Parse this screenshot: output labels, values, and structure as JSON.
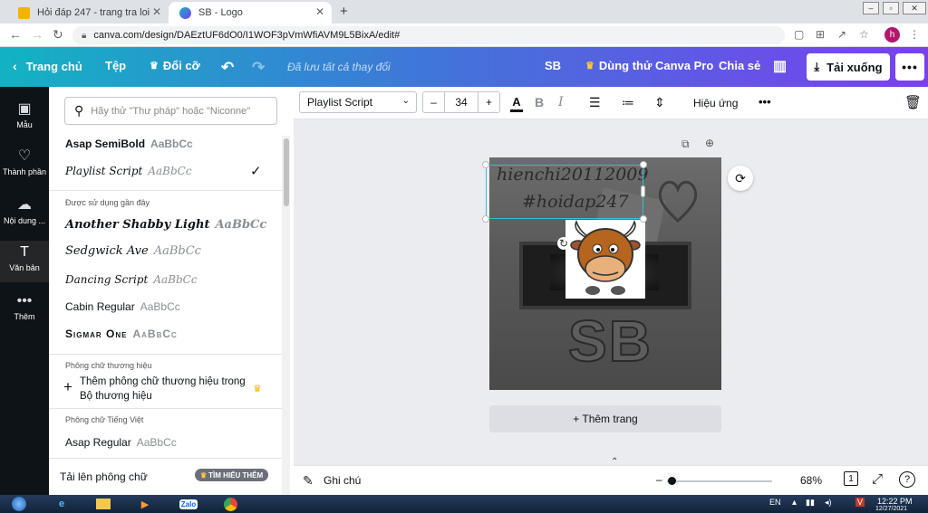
{
  "browser": {
    "tabs": [
      {
        "title": "Hỏi đáp 247 - trang tra loi",
        "active": false
      },
      {
        "title": "SB - Logo",
        "active": true
      }
    ],
    "new_tab": "+",
    "url": "canva.com/design/DAEztUF6dO0/I1WOF3pVmWfiAVM9L5BixA/edit#",
    "profile_initial": "h"
  },
  "header": {
    "home": "Trang chủ",
    "file": "Tệp",
    "resize": "Đổi cỡ",
    "saved_status": "Đã lưu tất cả thay đổi",
    "design_name": "SB",
    "try_pro": "Dùng thử Canva Pro",
    "share": "Chia sẻ",
    "download": "Tải xuống"
  },
  "rail": [
    {
      "label": "Mẫu",
      "icon": "template-icon"
    },
    {
      "label": "Thành phần",
      "icon": "elements-icon"
    },
    {
      "label": "Nội dung ...",
      "icon": "upload-icon"
    },
    {
      "label": "Văn bản",
      "icon": "text-icon"
    },
    {
      "label": "Thêm",
      "icon": "more-icon"
    }
  ],
  "font_panel": {
    "search_placeholder": "Hãy thử \"Thư pháp\" hoặc \"Niconne\"",
    "top_fonts": [
      {
        "name": "Asap SemiBold",
        "sample": "AaBbCc"
      },
      {
        "name": "Playlist Script",
        "sample": "AaBbCc",
        "selected": true
      }
    ],
    "recent_heading": "Được sử dụng gần đây",
    "recent_fonts": [
      {
        "name": "Another Shabby Light",
        "sample": "AaBbCc"
      },
      {
        "name": "Sedgwick Ave",
        "sample": "AaBbCc"
      },
      {
        "name": "Dancing Script",
        "sample": "AaBbCc"
      },
      {
        "name": "Cabin Regular",
        "sample": "AaBbCc"
      },
      {
        "name": "Sigmar One",
        "sample": "AaBbCc"
      }
    ],
    "brand_heading": "Phông chữ thương hiệu",
    "brand_add": "Thêm phông chữ thương hiệu trong Bộ thương hiệu",
    "vn_heading": "Phông chữ Tiếng Việt",
    "vn_fonts": [
      {
        "name": "Asap Regular",
        "sample": "AaBbCc"
      }
    ],
    "upload_label": "Tải lên phông chữ",
    "learn_more": "TÌM HIỂU THÊM"
  },
  "toolbar": {
    "font_name": "Playlist Script",
    "font_size": "34",
    "minus": "–",
    "plus": "+",
    "bold": "B",
    "italic": "I",
    "effects": "Hiệu ứng",
    "more": "•••"
  },
  "canvas": {
    "text_line1": "hienchi20112009",
    "text_line2": "#hoidap247",
    "big_text": "SB",
    "add_page": "+ Thêm trang"
  },
  "bottom": {
    "notes": "Ghi chú",
    "zoom": "68%",
    "page_count": "1",
    "help": "?"
  },
  "taskbar": {
    "lang": "EN",
    "time": "12:22 PM",
    "date": "12/27/2021"
  },
  "colors": {
    "selection": "#2fc2d3",
    "header_start": "#12b3c3",
    "header_end": "#7a3ff0",
    "rail": "#0e1318"
  }
}
